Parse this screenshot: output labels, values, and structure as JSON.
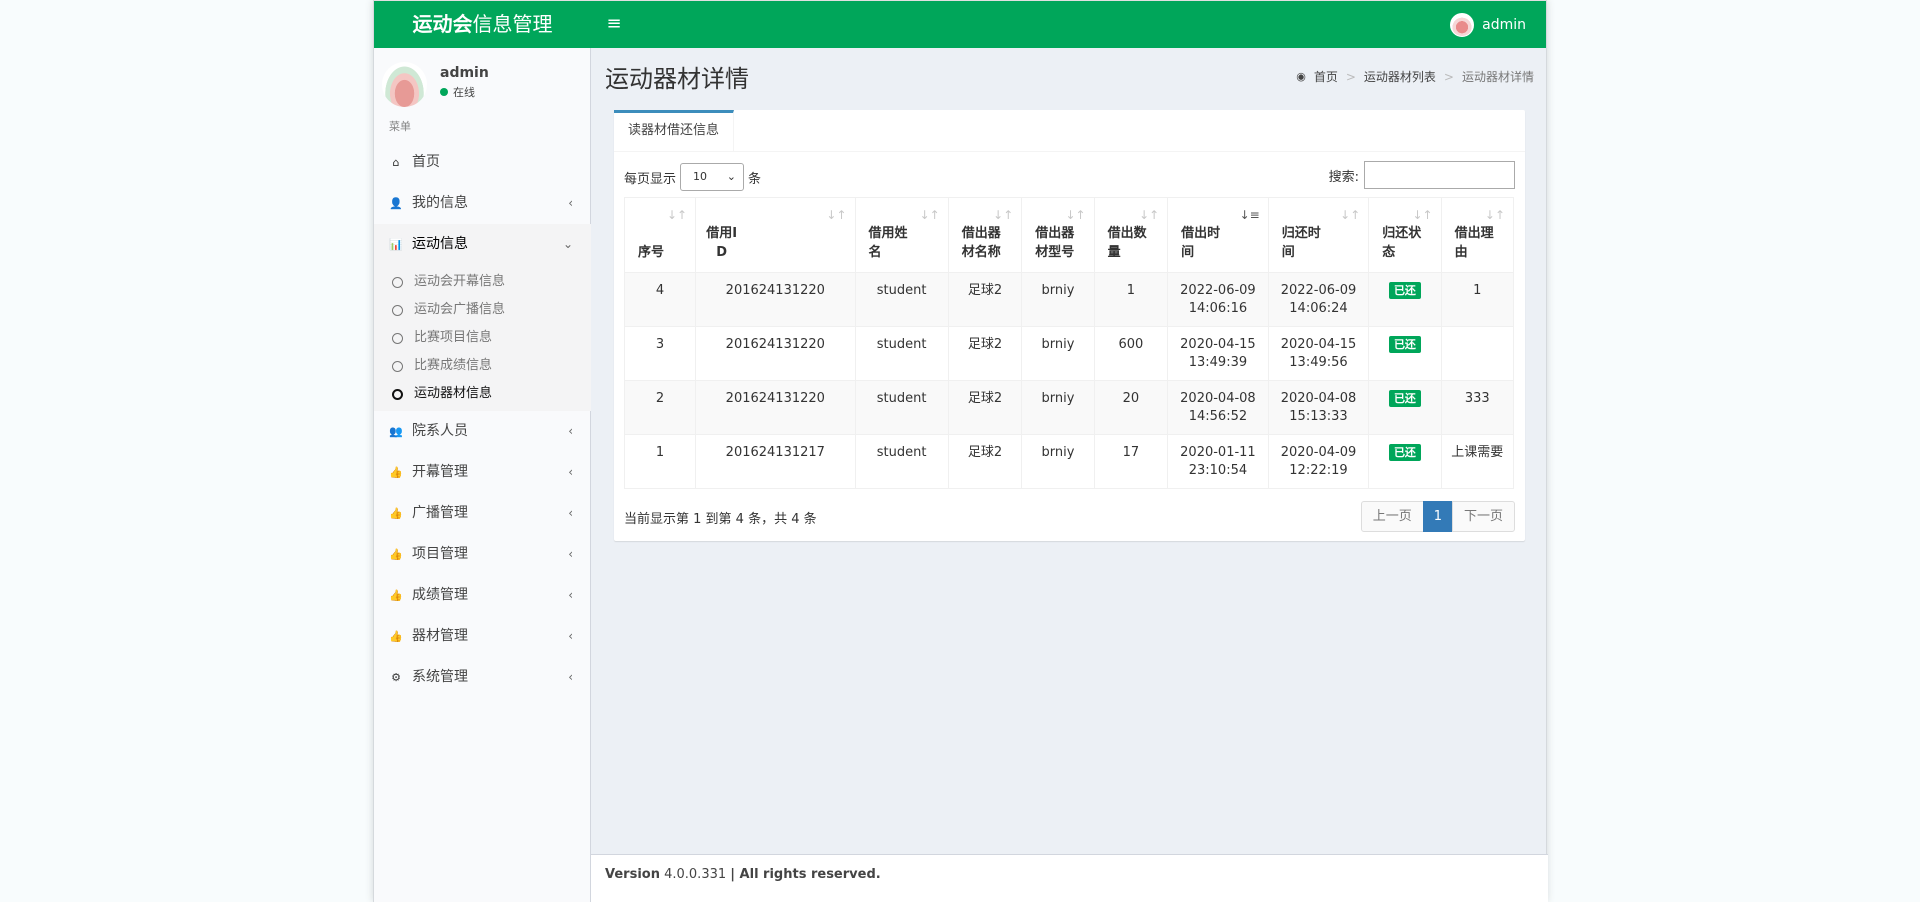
{
  "header": {
    "logo_bold": "运动会",
    "logo_rest": "信息管理",
    "toggle_icon": "≡",
    "user": "admin"
  },
  "sidebar": {
    "user_name": "admin",
    "status": "在线",
    "menu_header": "菜单",
    "items": [
      {
        "label": "首页",
        "icon": "home-icon",
        "glyph": "⌂",
        "chevron": ""
      },
      {
        "label": "我的信息",
        "icon": "user-icon",
        "glyph": "👤",
        "chevron": "‹"
      },
      {
        "label": "运动信息",
        "icon": "bar-chart-icon",
        "glyph": "📊",
        "chevron": "⌄"
      },
      {
        "label": "院系人员",
        "icon": "users-icon",
        "glyph": "👥",
        "chevron": "‹"
      },
      {
        "label": "开幕管理",
        "icon": "thumbs-up-icon",
        "glyph": "👍",
        "chevron": "‹"
      },
      {
        "label": "广播管理",
        "icon": "thumbs-up-icon",
        "glyph": "👍",
        "chevron": "‹"
      },
      {
        "label": "项目管理",
        "icon": "thumbs-up-icon",
        "glyph": "👍",
        "chevron": "‹"
      },
      {
        "label": "成绩管理",
        "icon": "thumbs-up-icon",
        "glyph": "👍",
        "chevron": "‹"
      },
      {
        "label": "器材管理",
        "icon": "thumbs-up-icon",
        "glyph": "👍",
        "chevron": "‹"
      },
      {
        "label": "系统管理",
        "icon": "gear-icon",
        "glyph": "⚙",
        "chevron": "‹"
      }
    ],
    "subitems": [
      "运动会开幕信息",
      "运动会广播信息",
      "比赛项目信息",
      "比赛成绩信息",
      "运动器材信息"
    ]
  },
  "page": {
    "title": "运动器材详情",
    "breadcrumb": [
      "首页",
      "运动器材列表",
      "运动器材详情"
    ],
    "breadcrumb_sep": ">"
  },
  "box": {
    "tab": "读器材借还信息",
    "length_prefix": "每页显示",
    "length_value": "10",
    "length_suffix": "条",
    "search_label": "搜索:",
    "columns": [
      "序号",
      "借用ID",
      "借用姓名",
      "借出器材名称",
      "借出器材型号",
      "借出数量",
      "借出时间",
      "归还时间",
      "归还状态",
      "借出理由"
    ],
    "rows": [
      [
        "4",
        "201624131220",
        "student",
        "足球2",
        "brniy",
        "1",
        "2022-06-09 14:06:16",
        "2022-06-09 14:06:24",
        "已还",
        "1"
      ],
      [
        "3",
        "201624131220",
        "student",
        "足球2",
        "brniy",
        "600",
        "2020-04-15 13:49:39",
        "2020-04-15 13:49:56",
        "已还",
        ""
      ],
      [
        "2",
        "201624131220",
        "student",
        "足球2",
        "brniy",
        "20",
        "2020-04-08 14:56:52",
        "2020-04-08 15:13:33",
        "已还",
        "333"
      ],
      [
        "1",
        "201624131217",
        "student",
        "足球2",
        "brniy",
        "17",
        "2020-01-11 23:10:54",
        "2020-04-09 12:22:19",
        "已还",
        "上课需要"
      ]
    ],
    "info": "当前显示第 1 到第 4 条，共 4 条",
    "pager": {
      "prev": "上一页",
      "current": "1",
      "next": "下一页"
    }
  },
  "footer": {
    "version_label": "Version",
    "version": "4.0.0.331",
    "rights": "| All rights reserved."
  }
}
